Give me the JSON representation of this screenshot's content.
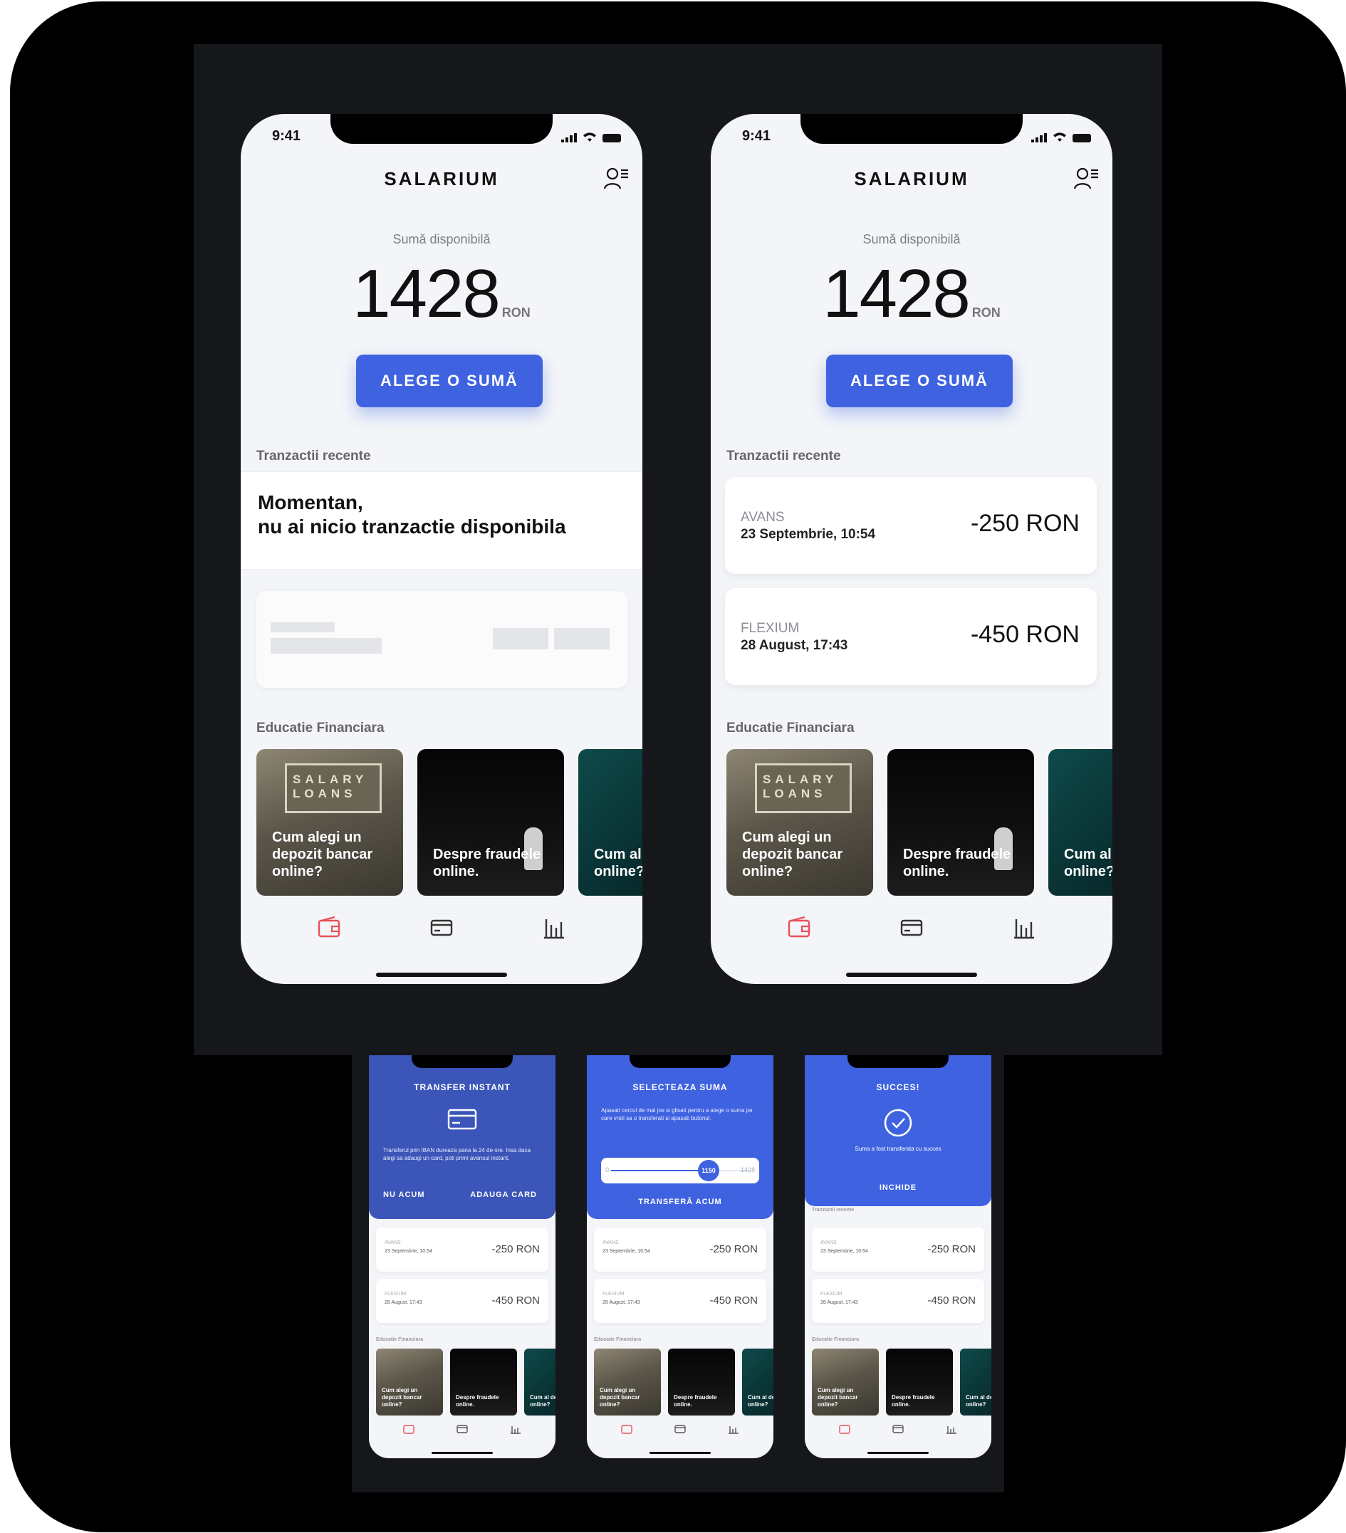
{
  "app": {
    "status_time": "9:41",
    "brand": "SALARIUM",
    "available_label": "Sumă disponibilă",
    "available_amount": "1428",
    "currency": "RON",
    "cta_label": "ALEGE O SUMĂ",
    "recent_label": "Tranzactii recente",
    "education_label": "Educatie Financiara",
    "accent_color": "#3f63e0",
    "tab_active_color": "#e8505b"
  },
  "empty_state": {
    "line1": "Momentan,",
    "line2": "nu ai nicio tranzactie disponibila"
  },
  "transactions": [
    {
      "name": "AVANS",
      "date": "23 Septembrie, 10:54",
      "amount": "-250 RON"
    },
    {
      "name": "FLEXIUM",
      "date": "28 August, 17:43",
      "amount": "-450 RON"
    }
  ],
  "education": [
    {
      "title": "Cum alegi un depozit bancar online?",
      "sign_text": "SALARY LOANS"
    },
    {
      "title": "Despre fraudele online."
    },
    {
      "title": "Cum al depozit online?"
    }
  ],
  "tabs": [
    {
      "icon": "wallet-icon",
      "active": true
    },
    {
      "icon": "card-icon",
      "active": false
    },
    {
      "icon": "chart-icon",
      "active": false
    }
  ],
  "transfer_sheet": {
    "title": "TRANSFER INSTANT",
    "text": "Transferul prin IBAN dureaza pana la 24 de ore. Insa daca alegi sa adaugi un card, poti primi avansul instant.",
    "cancel_label": "NU ACUM",
    "add_label": "ADAUGA CARD",
    "color": "#3b56b8"
  },
  "select_sheet": {
    "title": "SELECTEAZA SUMA",
    "text": "Apasati cercul de mai jos si glisati pentru a alege o suma pe care vreti sa o transferati si apasati butonul.",
    "min": "0",
    "value": "1150",
    "max": "1428",
    "button_label": "TRANSFERĂ ACUM",
    "color": "#3f63e0"
  },
  "success_sheet": {
    "title": "SUCCES!",
    "text": "Suma a fost transferata cu succes",
    "button_label": "INCHIDE",
    "color": "#3f63e0"
  }
}
